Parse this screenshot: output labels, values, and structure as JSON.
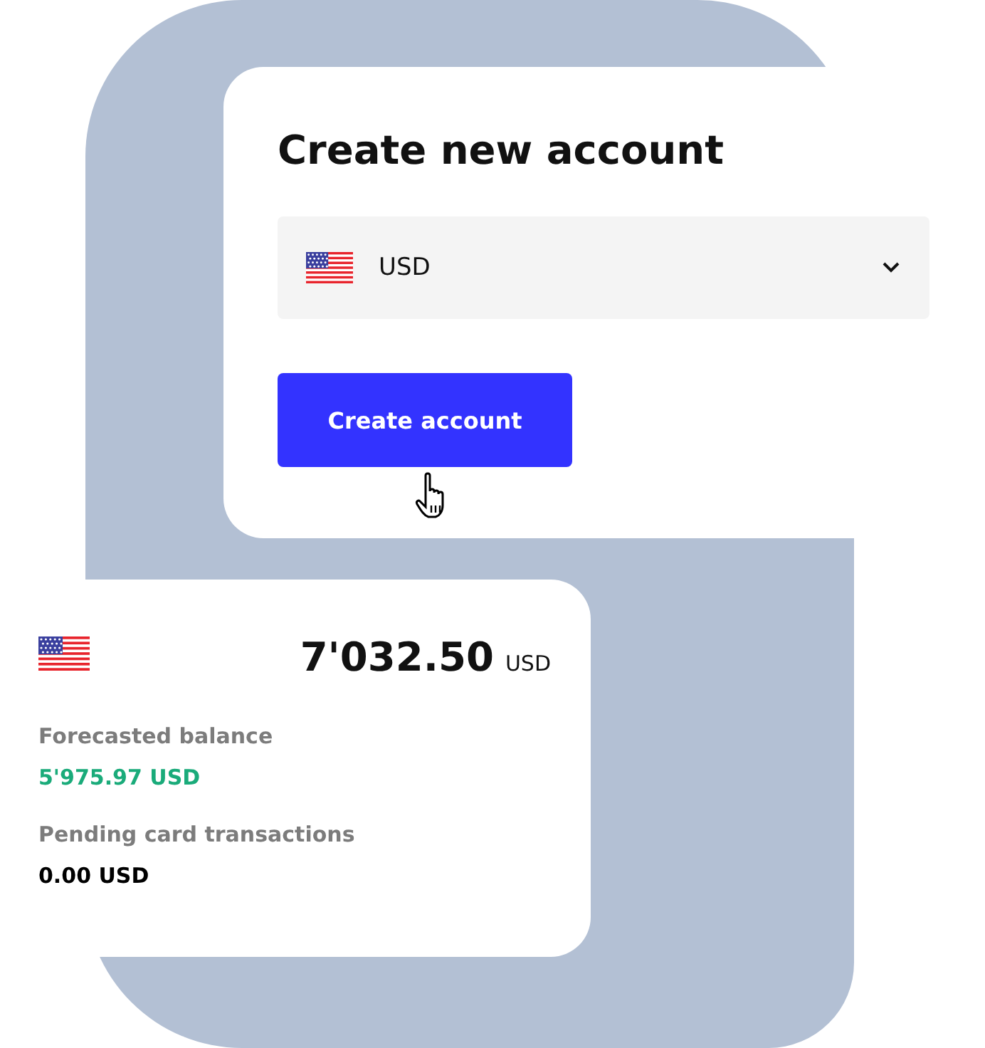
{
  "create_account": {
    "title": "Create new account",
    "currency_select": {
      "value": "USD"
    },
    "button": "Create account"
  },
  "balance_card": {
    "amount": "7'032.50",
    "currency": "USD",
    "details": [
      {
        "label": "Forecasted balance",
        "value": "5'975.97 USD",
        "color": "#1aab7a"
      },
      {
        "label": "Pending card transactions",
        "value": "0.00 USD",
        "color": "#000000"
      }
    ]
  }
}
